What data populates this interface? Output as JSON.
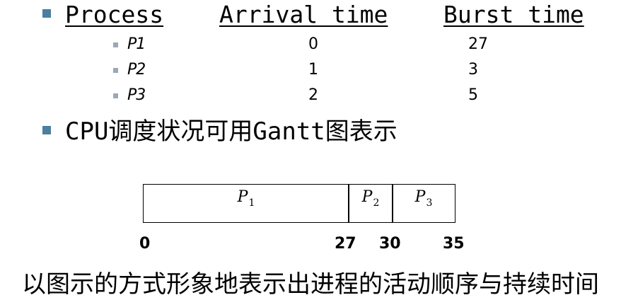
{
  "table": {
    "headers": [
      "Process",
      "Arrival time",
      "Burst time"
    ],
    "rows": [
      {
        "process": "P1",
        "arrival": "0",
        "burst": "27"
      },
      {
        "process": "P2",
        "arrival": "1",
        "burst": "3"
      },
      {
        "process": "P3",
        "arrival": "2",
        "burst": "5"
      }
    ]
  },
  "bullet2": {
    "text": "CPU调度状况可用Gantt图表示"
  },
  "gantt": {
    "segments": [
      {
        "label": "P",
        "sub": "1",
        "start": 0,
        "end": 27
      },
      {
        "label": "P",
        "sub": "2",
        "start": 27,
        "end": 30
      },
      {
        "label": "P",
        "sub": "3",
        "start": 30,
        "end": 35
      }
    ],
    "ticks": [
      "0",
      "27",
      "30",
      "35"
    ]
  },
  "caption": "以图示的方式形象地表示出进程的活动顺序与持续时间",
  "colors": {
    "bullet_large": "#4a7f9f",
    "bullet_small": "#9aa8b8"
  }
}
